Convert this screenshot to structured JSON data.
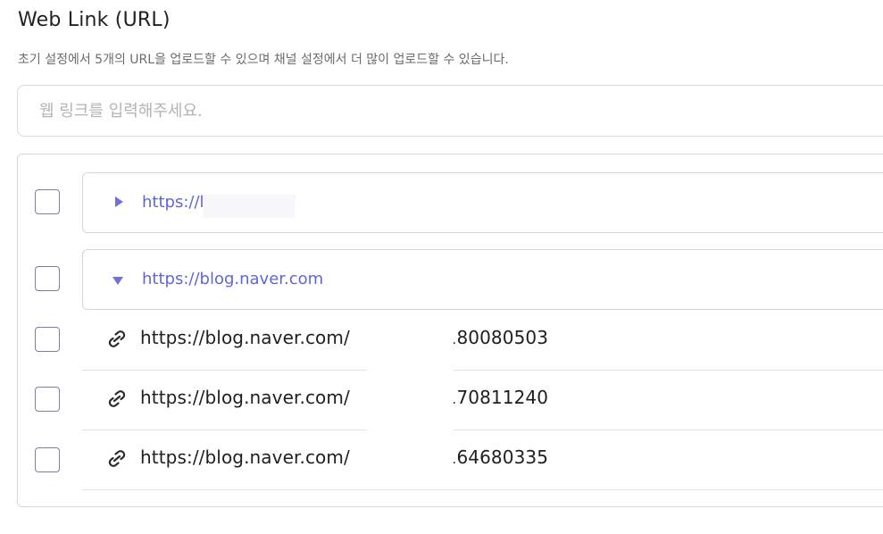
{
  "section": {
    "title": "Web Link (URL)",
    "description": "초기 설정에서 5개의 URL을 업로드할 수 있으며 채널 설정에서 더 많이 업로드할 수 있습니다."
  },
  "url_input": {
    "value": "",
    "placeholder": "웹 링크를 입력해주세요."
  },
  "groups": [
    {
      "url": "https://l            ac.kr",
      "expanded": false,
      "checked": false
    },
    {
      "url": "https://blog.naver.com",
      "expanded": true,
      "checked": false
    }
  ],
  "children": [
    {
      "prefix": "https://blog.naver.com/",
      "suffix": "3180080503",
      "checked": false
    },
    {
      "prefix": "https://blog.naver.com/",
      "suffix": "3170811240",
      "checked": false
    },
    {
      "prefix": "https://blog.naver.com/",
      "suffix": "3164680335",
      "checked": false
    }
  ],
  "icons": {
    "expand": "caret-right-icon",
    "collapse": "caret-down-icon",
    "link": "link-icon"
  },
  "colors": {
    "accent": "#6066d6",
    "border": "#d4d4d9"
  }
}
